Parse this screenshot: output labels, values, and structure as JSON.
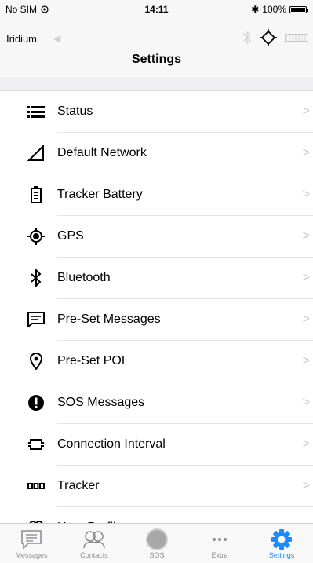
{
  "status_bar": {
    "carrier": "No SIM",
    "time": "14:11",
    "battery": "100%",
    "battery_level": 1.0,
    "icons": [
      "wifi-icon",
      "bluetooth-icon",
      "battery-icon"
    ]
  },
  "nav": {
    "provider": "Iridium",
    "title": "Settings",
    "icons": [
      "back-arrow-icon",
      "bluetooth-off-icon",
      "gps-target-icon",
      "signal-bar-icon"
    ]
  },
  "menu": {
    "items": [
      {
        "label": "Status",
        "icon": "list-icon"
      },
      {
        "label": "Default Network",
        "icon": "signal-triangle-icon"
      },
      {
        "label": "Tracker Battery",
        "icon": "battery-icon"
      },
      {
        "label": "GPS",
        "icon": "gps-icon"
      },
      {
        "label": "Bluetooth",
        "icon": "bluetooth-icon"
      },
      {
        "label": "Pre-Set Messages",
        "icon": "message-icon"
      },
      {
        "label": "Pre-Set POI",
        "icon": "location-pin-icon"
      },
      {
        "label": "SOS Messages",
        "icon": "alert-icon"
      },
      {
        "label": "Connection Interval",
        "icon": "interval-icon"
      },
      {
        "label": "Tracker",
        "icon": "tracker-icon"
      },
      {
        "label": "User Profile",
        "icon": "user-icon"
      }
    ],
    "chevron": ">"
  },
  "tabbar": {
    "tabs": [
      {
        "label": "Messages",
        "icon": "messages-icon"
      },
      {
        "label": "Contacts",
        "icon": "contacts-icon"
      },
      {
        "label": "SOS",
        "icon": "sos-icon"
      },
      {
        "label": "Extra",
        "icon": "more-icon"
      },
      {
        "label": "Settings",
        "icon": "settings-gear-icon"
      }
    ],
    "active": "Settings",
    "active_color": "#1a8cff",
    "inactive_color": "#8e8e93"
  }
}
